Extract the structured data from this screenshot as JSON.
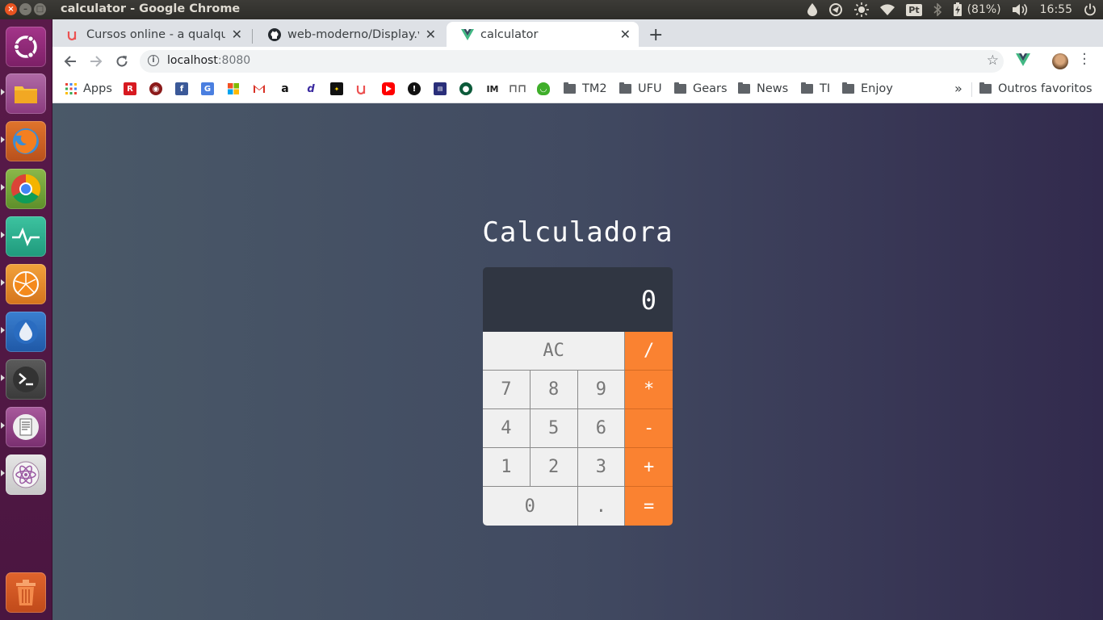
{
  "system": {
    "window_title": "calculator - Google Chrome",
    "battery": "(81%)",
    "clock": "16:55",
    "keyboard_lang": "Pt"
  },
  "launcher": {
    "apps": [
      "ubuntu-dash",
      "files",
      "firefox",
      "chrome",
      "system-monitor",
      "oranges-app",
      "drop-app",
      "terminal",
      "text-editor",
      "atom",
      "trash"
    ]
  },
  "browser": {
    "tabs": [
      {
        "label": "Cursos online - a qualquer",
        "favicon": "udemy-icon"
      },
      {
        "label": "web-moderno/Display.vue",
        "favicon": "github-icon"
      },
      {
        "label": "calculator",
        "favicon": "vue-icon",
        "active": true
      }
    ],
    "new_tab": "+",
    "url_host": "localhost",
    "url_port": ":8080",
    "bookmarks": {
      "apps_label": "Apps",
      "folders": [
        "TM2",
        "UFU",
        "Gears",
        "News",
        "TI",
        "Enjoy"
      ],
      "other": "Outros favoritos",
      "overflow": "»"
    }
  },
  "calculator": {
    "title": "Calculadora",
    "display_value": "0",
    "keys": {
      "clear": "AC",
      "divide": "/",
      "seven": "7",
      "eight": "8",
      "nine": "9",
      "multiply": "*",
      "four": "4",
      "five": "5",
      "six": "6",
      "minus": "-",
      "one": "1",
      "two": "2",
      "three": "3",
      "plus": "+",
      "zero": "0",
      "dot": ".",
      "equals": "="
    },
    "colors": {
      "operator": "#fa8231",
      "display_bg": "#303642",
      "key_bg": "#f0f0f0"
    }
  }
}
